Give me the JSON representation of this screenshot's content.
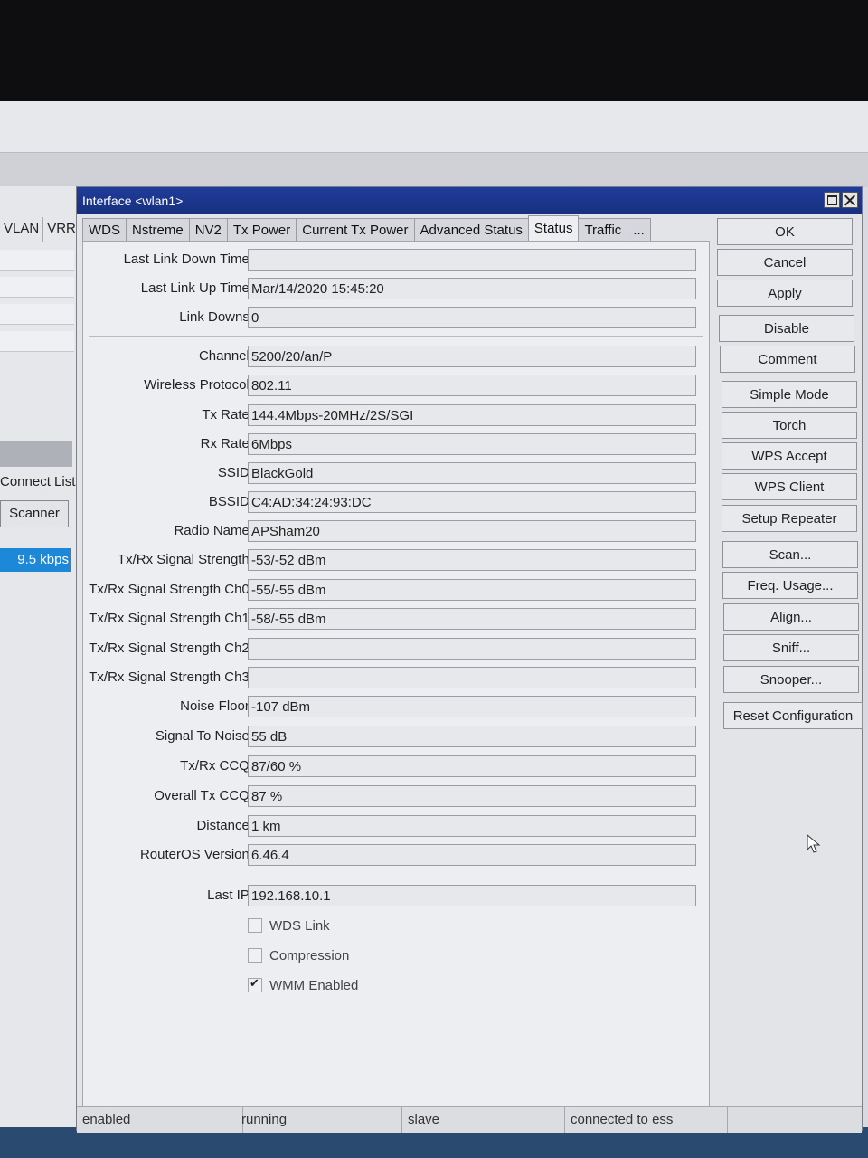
{
  "background_window": {
    "tabs": [
      "VLAN",
      "VRRP"
    ],
    "connect_list": "Connect List",
    "scanner_button": "Scanner",
    "rate_value": "9.5 kbps"
  },
  "dialog": {
    "title": "Interface <wlan1>",
    "tabs": [
      "WDS",
      "Nstreme",
      "NV2",
      "Tx Power",
      "Current Tx Power",
      "Advanced Status",
      "Status",
      "Traffic",
      "..."
    ],
    "active_tab": "Status",
    "fields": [
      {
        "label": "Last Link Down Time:",
        "value": ""
      },
      {
        "label": "Last Link Up Time:",
        "value": "Mar/14/2020 15:45:20"
      },
      {
        "label": "Link Downs:",
        "value": "0"
      },
      {
        "label": "Channel:",
        "value": "5200/20/an/P"
      },
      {
        "label": "Wireless Protocol:",
        "value": "802.11"
      },
      {
        "label": "Tx Rate:",
        "value": "144.4Mbps-20MHz/2S/SGI"
      },
      {
        "label": "Rx Rate:",
        "value": "6Mbps"
      },
      {
        "label": "SSID:",
        "value": "BlackGold"
      },
      {
        "label": "BSSID:",
        "value": "C4:AD:34:24:93:DC"
      },
      {
        "label": "Radio Name:",
        "value": "APSham20"
      },
      {
        "label": "Tx/Rx Signal Strength:",
        "value": "-53/-52 dBm"
      },
      {
        "label": "Tx/Rx Signal Strength Ch0:",
        "value": "-55/-55 dBm"
      },
      {
        "label": "Tx/Rx Signal Strength Ch1:",
        "value": "-58/-55 dBm"
      },
      {
        "label": "Tx/Rx Signal Strength Ch2:",
        "value": ""
      },
      {
        "label": "Tx/Rx Signal Strength Ch3:",
        "value": ""
      },
      {
        "label": "Noise Floor:",
        "value": "-107 dBm"
      },
      {
        "label": "Signal To Noise:",
        "value": "55 dB"
      },
      {
        "label": "Tx/Rx CCQ:",
        "value": "87/60 %"
      },
      {
        "label": "Overall Tx CCQ:",
        "value": "87 %"
      },
      {
        "label": "Distance:",
        "value": "1 km"
      },
      {
        "label": "RouterOS Version:",
        "value": "6.46.4"
      },
      {
        "label": "Last IP:",
        "value": "192.168.10.1"
      }
    ],
    "checkboxes": [
      {
        "label": "WDS Link",
        "checked": false
      },
      {
        "label": "Compression",
        "checked": false
      },
      {
        "label": "WMM Enabled",
        "checked": true
      }
    ],
    "buttons": [
      "OK",
      "Cancel",
      "Apply",
      "Disable",
      "Comment",
      "Simple Mode",
      "Torch",
      "WPS Accept",
      "WPS Client",
      "Setup Repeater",
      "Scan...",
      "Freq. Usage...",
      "Align...",
      "Sniff...",
      "Snooper...",
      "Reset Configuration"
    ],
    "status_bar": [
      "enabled",
      "running",
      "slave",
      "connected to ess"
    ]
  }
}
